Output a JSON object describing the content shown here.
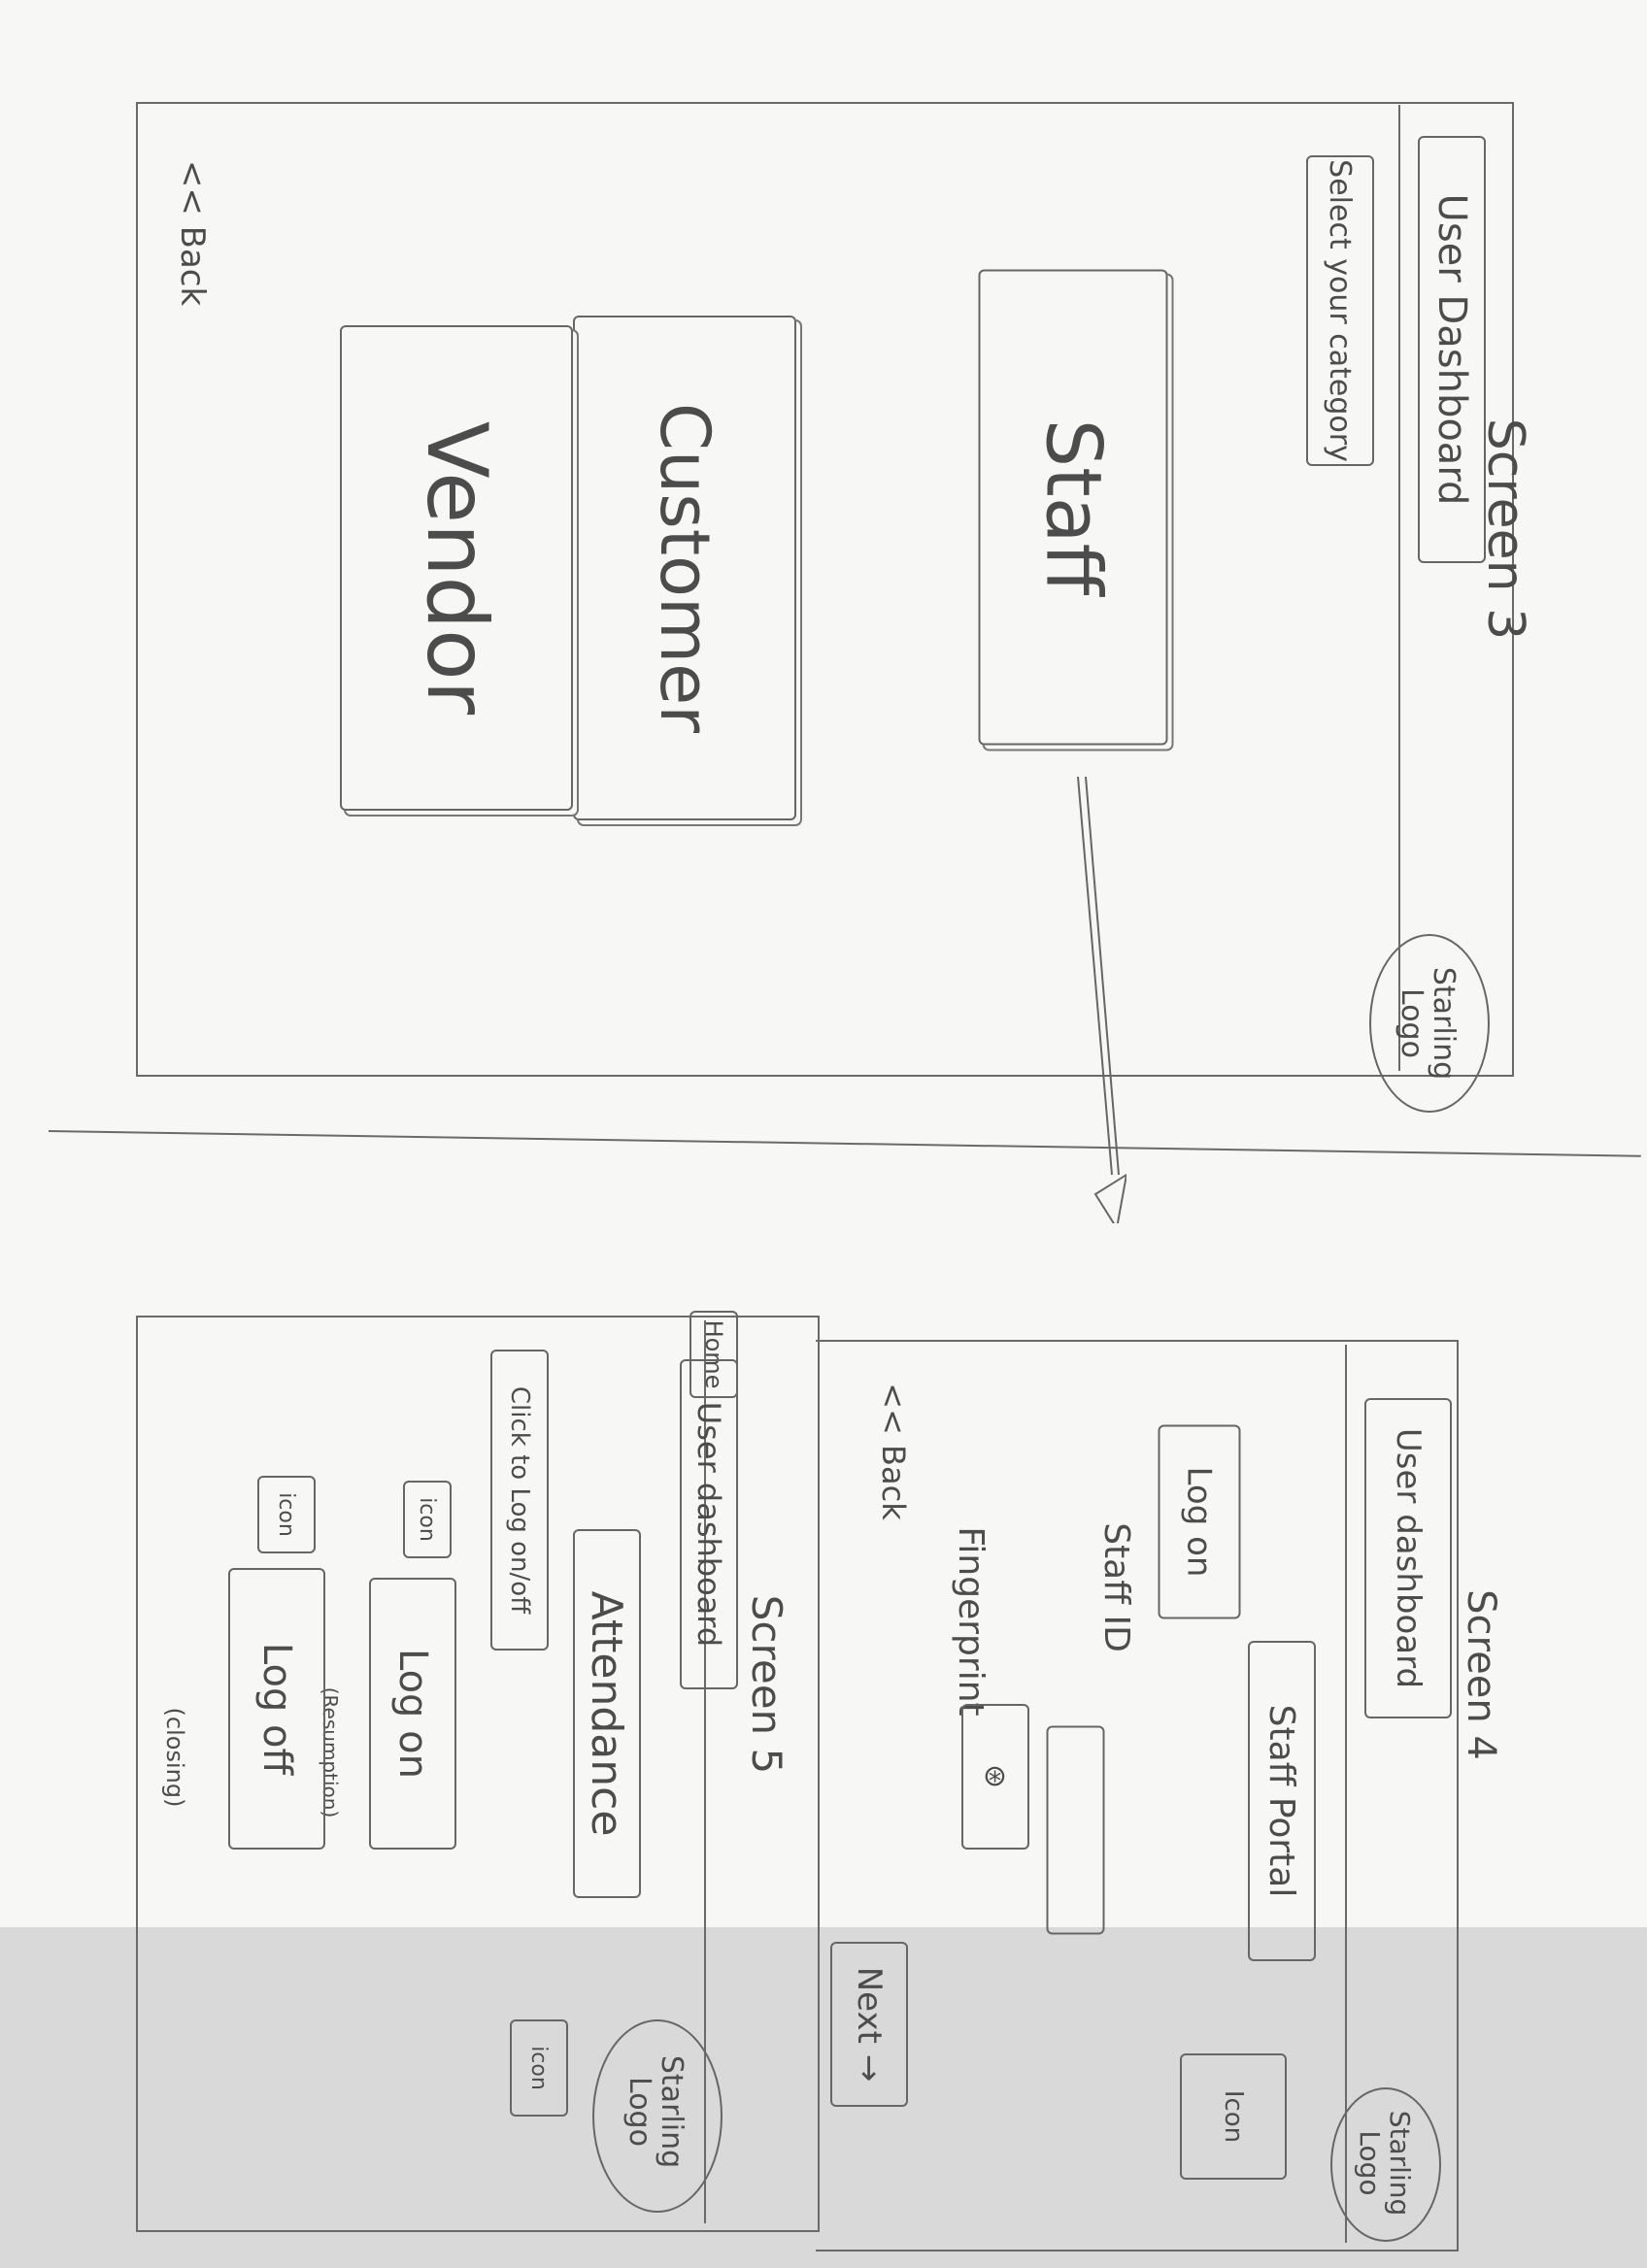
{
  "screen3": {
    "title": "Screen 3",
    "header": "User Dashboard",
    "logo": "Starling Logo",
    "prompt": "Select your category",
    "categories": [
      "Staff",
      "Customer",
      "Vendor"
    ],
    "back": "<< Back"
  },
  "screen4": {
    "title": "Screen 4",
    "header": "User dashboard",
    "logo": "Starling Logo",
    "portal": "Staff Portal",
    "logon": "Log on",
    "staff_id_label": "Staff ID",
    "fingerprint_label": "Fingerprint",
    "next": "Next →",
    "back": "<< Back",
    "small_box": "Icon"
  },
  "screen5": {
    "title": "Screen 5",
    "home_tab": "Home",
    "header": "User dashboard",
    "logo": "Starling Logo",
    "attendance": "Attendance",
    "click_label": "Click to Log on/off",
    "icon_label": "icon",
    "logon": "Log on",
    "logon_note": "(Resumption)",
    "logoff": "Log off",
    "logoff_note": "(closing)"
  }
}
